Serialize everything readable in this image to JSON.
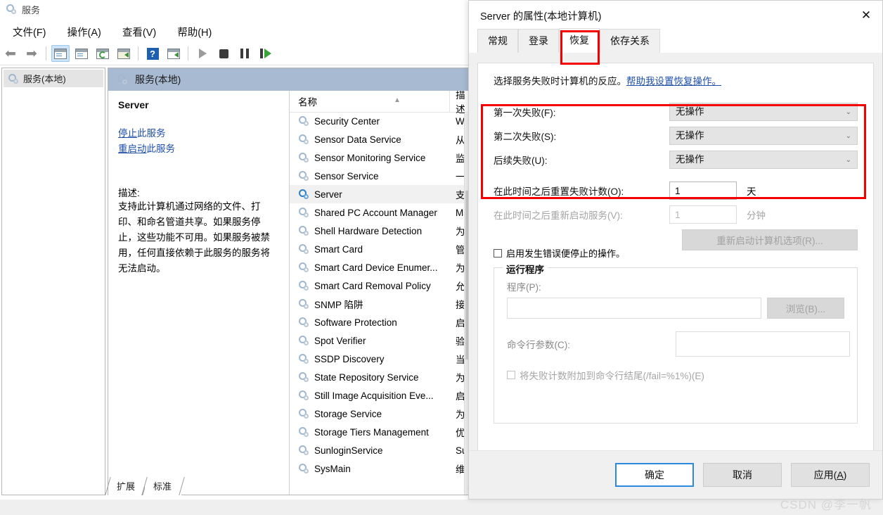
{
  "app": {
    "title": "服务",
    "icon": "gear-icon",
    "menu": [
      "文件(F)",
      "操作(A)",
      "查看(V)",
      "帮助(H)"
    ],
    "toolbar_icons": [
      "back-arrow-icon",
      "forward-arrow-icon",
      "show-hide-tree-icon",
      "properties-icon",
      "refresh-icon",
      "export-list-icon",
      "help-icon",
      "show-action-pane-icon",
      "start-service-icon",
      "stop-service-icon",
      "pause-service-icon",
      "restart-service-icon"
    ]
  },
  "tree": {
    "items": [
      {
        "label": "服务(本地)",
        "icon": "gear-icon"
      }
    ]
  },
  "content": {
    "header": {
      "label": "服务(本地)",
      "icon": "gear-icon"
    },
    "detail": {
      "service_name": "Server",
      "links": [
        {
          "link": "停止",
          "rest": "此服务"
        },
        {
          "link": "重启动",
          "rest": "此服务"
        }
      ],
      "desc_heading": "描述:",
      "desc_text": "支持此计算机通过网络的文件、打印、和命名管道共享。如果服务停止，这些功能不可用。如果服务被禁用，任何直接依赖于此服务的服务将无法启动。"
    },
    "list": {
      "columns": [
        "名称",
        "描述"
      ],
      "sort_indicator": "▲",
      "selected": "Server",
      "rows": [
        {
          "name": "Security Center",
          "desc": "WS"
        },
        {
          "name": "Sensor Data Service",
          "desc": "从名"
        },
        {
          "name": "Sensor Monitoring Service",
          "desc": "监视"
        },
        {
          "name": "Sensor Service",
          "desc": "一项"
        },
        {
          "name": "Server",
          "desc": "支持"
        },
        {
          "name": "Shared PC Account Manager",
          "desc": "Ma"
        },
        {
          "name": "Shell Hardware Detection",
          "desc": "为自"
        },
        {
          "name": "Smart Card",
          "desc": "管理"
        },
        {
          "name": "Smart Card Device Enumer...",
          "desc": "为给"
        },
        {
          "name": "Smart Card Removal Policy",
          "desc": "允许"
        },
        {
          "name": "SNMP 陷阱",
          "desc": "接收"
        },
        {
          "name": "Software Protection",
          "desc": "启用"
        },
        {
          "name": "Spot Verifier",
          "desc": "验证"
        },
        {
          "name": "SSDP Discovery",
          "desc": "当发"
        },
        {
          "name": "State Repository Service",
          "desc": "为应"
        },
        {
          "name": "Still Image Acquisition Eve...",
          "desc": "启动"
        },
        {
          "name": "Storage Service",
          "desc": "为存"
        },
        {
          "name": "Storage Tiers Management",
          "desc": "优化"
        },
        {
          "name": "SunloginService",
          "desc": "Su"
        },
        {
          "name": "SysMain",
          "desc": "维护"
        }
      ]
    },
    "bottom_tabs": [
      "扩展",
      "标准"
    ]
  },
  "dialog": {
    "title": "Server 的属性(本地计算机)",
    "close_label": "✕",
    "tabs": [
      {
        "label": "常规",
        "active": false
      },
      {
        "label": "登录",
        "active": false
      },
      {
        "label": "恢复",
        "active": true
      },
      {
        "label": "依存关系",
        "active": false
      }
    ],
    "intro_text": "选择服务失败时计算机的反应。",
    "intro_link": "帮助我设置恢复操作。",
    "failure_actions": [
      {
        "label": "第一次失败(F):",
        "value": "无操作"
      },
      {
        "label": "第二次失败(S):",
        "value": "无操作"
      },
      {
        "label": "后续失败(U):",
        "value": "无操作"
      }
    ],
    "dropdown_chevron": "⌄",
    "reset_count": {
      "label": "在此时间之后重置失败计数(O):",
      "value": "1",
      "unit": "天"
    },
    "restart_after": {
      "label": "在此时间之后重新启动服务(V):",
      "value": "1",
      "unit": "分钟"
    },
    "stop_on_error": {
      "label": "启用发生错误便停止的操作。",
      "checked": false
    },
    "restart_computer_button": "重新启动计算机选项(R)...",
    "run_program": {
      "group_label": "运行程序",
      "program_label": "程序(P):",
      "program_value": "",
      "browse_button": "浏览(B)...",
      "args_label": "命令行参数(C):",
      "args_value": "",
      "append_fail_label": "将失败计数附加到命令行结尾(/fail=%1%)(E)",
      "append_fail_checked": false
    },
    "footer_buttons": [
      {
        "label": "确定",
        "primary": true,
        "accel": ""
      },
      {
        "label": "取消",
        "primary": false,
        "accel": ""
      },
      {
        "label": "应用(",
        "primary": false,
        "accel": "A",
        "accel_suffix": ")"
      }
    ]
  },
  "annotations": {
    "highlight_color": "#f50000",
    "boxes": [
      "恢复-tab-highlight",
      "failure-actions-highlight"
    ]
  },
  "watermark": "CSDN @李一帆"
}
